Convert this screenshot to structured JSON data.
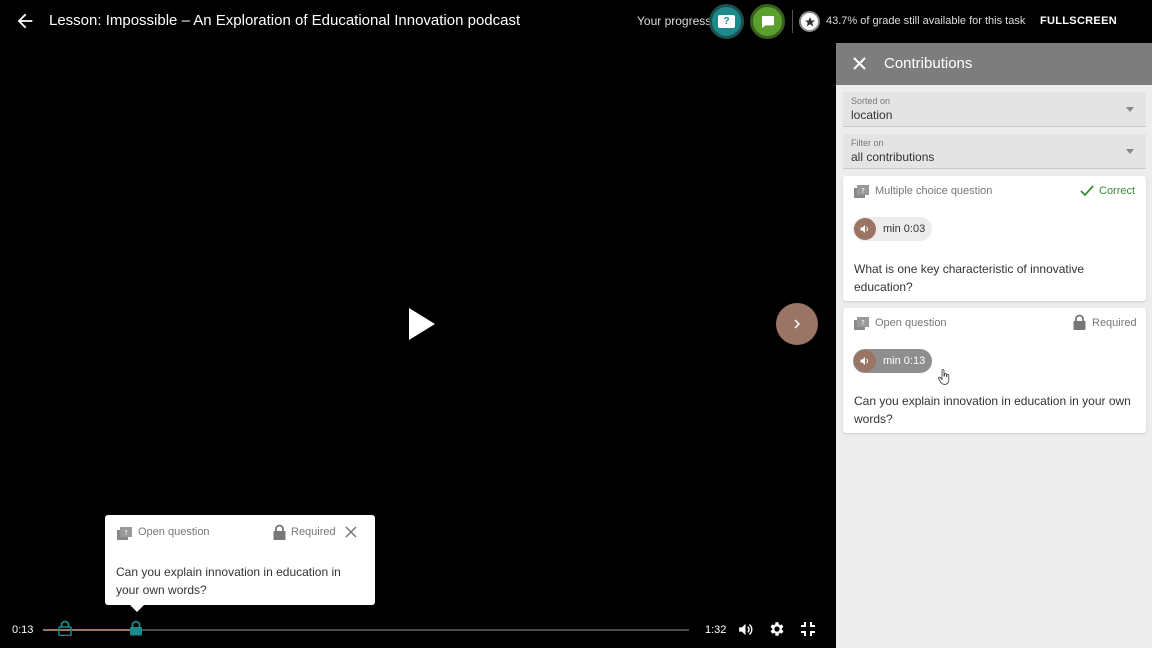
{
  "header": {
    "title": "Lesson: Impossible – An Exploration of Educational Innovation podcast",
    "progress_label": "Your progress",
    "grade_text": "43.7% of grade still available for this task",
    "fullscreen_label": "FULLSCREEN"
  },
  "colors": {
    "accent": "#9a7565",
    "teal": "#1a8a8a",
    "green": "#5aa02c",
    "correct": "#3c8a3c",
    "panel_header": "#7d7d7d"
  },
  "popup": {
    "type": "Open question",
    "status": "Required",
    "question": "Can you explain innovation in education in your own words?"
  },
  "player": {
    "current_time": "0:13",
    "total_time": "1:32",
    "progress": 0.141
  },
  "panel": {
    "title": "Contributions",
    "sort": {
      "label": "Sorted on",
      "value": "location"
    },
    "filter": {
      "label": "Filter on",
      "value": "all contributions"
    },
    "cards": [
      {
        "type": "Multiple choice question",
        "status": "Correct",
        "time": "min 0:03",
        "question": "What is one key characteristic of innovative education?"
      },
      {
        "type": "Open question",
        "status": "Required",
        "time": "min 0:13",
        "question": "Can you explain innovation in education in your own words?"
      }
    ]
  }
}
